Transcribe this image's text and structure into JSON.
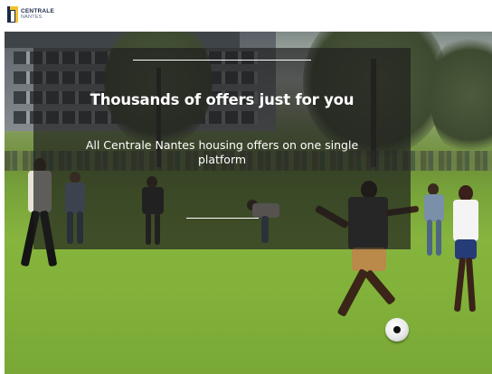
{
  "header": {
    "logo": {
      "line1": "CENTRALE",
      "line2": "NANTES",
      "icon": "centrale-nantes-logo-icon",
      "colors": {
        "gold": "#f2c12e",
        "navy": "#1b2a4a"
      }
    }
  },
  "hero": {
    "title": "Thousands of offers just for you",
    "subtitle": "All Centrale Nantes housing offers on one single platform",
    "background": "photo-students-playing-football-on-campus-lawn",
    "overlay_color": "#1e1e1e"
  }
}
